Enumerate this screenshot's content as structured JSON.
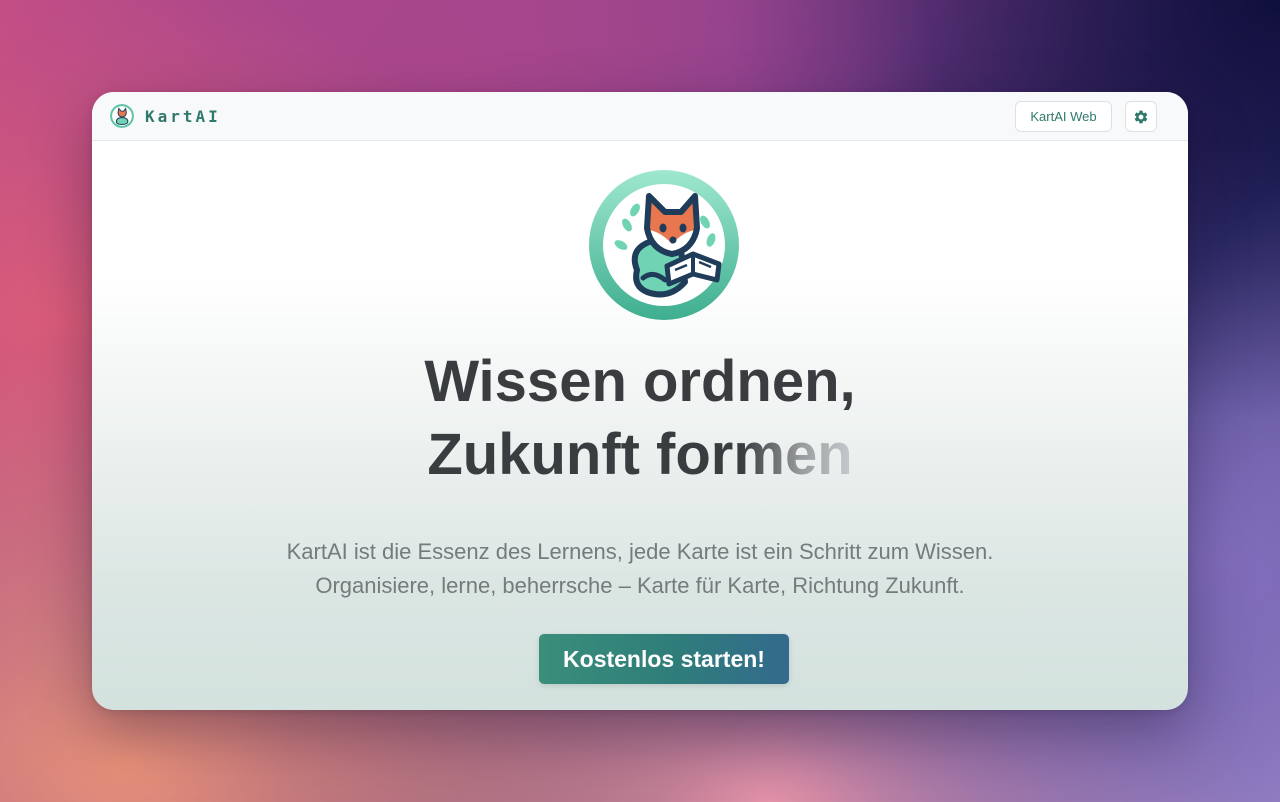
{
  "app": {
    "brand_name": "KartAI",
    "logo_icon": "fox-reading-book-logo"
  },
  "header": {
    "web_button_label": "KartAI Web",
    "settings_icon": "gear-icon"
  },
  "hero": {
    "headline_line1": "Wissen ordnen,",
    "headline_line2": "Zukunft formen",
    "subtitle_line1": "KartAI ist die Essenz des Lernens, jede Karte ist ein Schritt zum Wissen.",
    "subtitle_line2": "Organisiere, lerne, beherrsche – Karte für Karte, Richtung Zukunft.",
    "cta_label": "Kostenlos starten!"
  },
  "colors": {
    "brand_teal": "#2f7a6c",
    "headline": "#3a3d3f",
    "subtitle": "#767a7c",
    "cta_start": "#3a8e7a",
    "cta_end": "#336a8e",
    "fox_orange": "#e8764f",
    "fox_navy": "#1f3d5a",
    "ring_mint": "#6fd3b4"
  }
}
